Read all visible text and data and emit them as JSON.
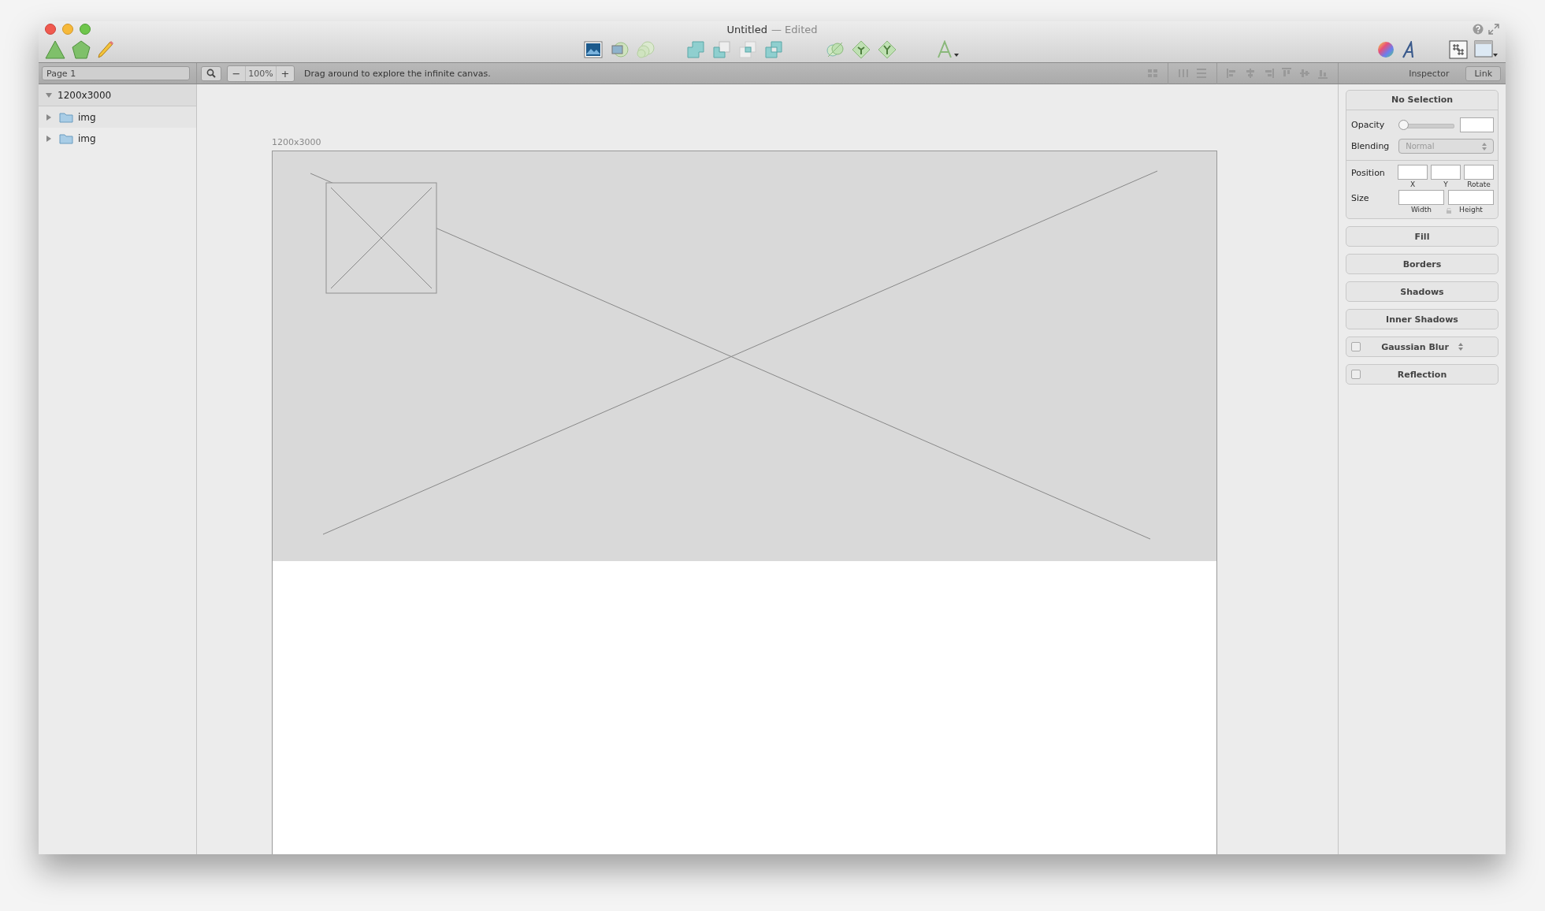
{
  "window": {
    "title": "Untitled",
    "status": "— Edited"
  },
  "page_field": {
    "value": "Page 1"
  },
  "zoom": {
    "minus": "−",
    "value": "100%",
    "plus": "+"
  },
  "hint": "Drag around to explore the infinite canvas.",
  "inspector_tabs": [
    {
      "label": "Inspector",
      "selected": true
    },
    {
      "label": "Link",
      "selected": false
    }
  ],
  "layers": [
    {
      "name": "1200x3000",
      "expanded": true,
      "children": [
        {
          "name": "img",
          "expanded": false
        },
        {
          "name": "img",
          "expanded": false
        }
      ]
    }
  ],
  "artboard": {
    "label": "1200x3000"
  },
  "inspector": {
    "title": "No Selection",
    "opacity": {
      "label": "Opacity",
      "level": 0
    },
    "blending": {
      "label": "Blending",
      "value": "Normal"
    },
    "position": {
      "label": "Position",
      "fields": [
        "X",
        "Y",
        "Rotate"
      ]
    },
    "size": {
      "label": "Size",
      "fields": [
        "Width",
        "Height"
      ]
    },
    "sections": [
      {
        "label": "Fill",
        "kind": "plain"
      },
      {
        "label": "Borders",
        "kind": "plain"
      },
      {
        "label": "Shadows",
        "kind": "plain"
      },
      {
        "label": "Inner Shadows",
        "kind": "plain"
      },
      {
        "label": "Gaussian Blur",
        "kind": "checkbox",
        "checked": false,
        "stepper": true
      },
      {
        "label": "Reflection",
        "kind": "checkbox",
        "checked": false
      }
    ]
  }
}
